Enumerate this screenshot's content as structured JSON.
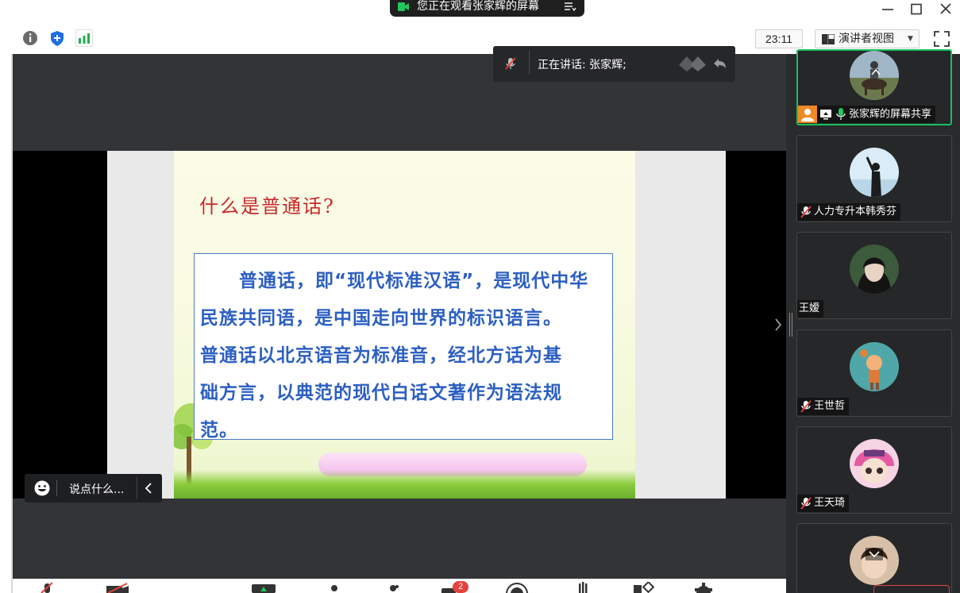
{
  "title_bar": {
    "share_notice": "您正在观看张家辉的屏幕",
    "controls": [
      "minimize",
      "maximize",
      "close"
    ]
  },
  "top_toolbar": {
    "icons": [
      "info-icon",
      "security-shield-icon",
      "network-signal-icon"
    ],
    "timer": "23:11",
    "view_label": "演讲者视图",
    "fullscreen": "fullscreen-icon"
  },
  "speaking_banner": {
    "text": "正在讲话: 张家辉;"
  },
  "slide": {
    "title": "什么是普通话?",
    "lines": [
      "普通话，即“现代标准汉语”，是现代中华",
      "民族共同语，是中国走向世界的标识语言。",
      "普通话以北京语音为标准音，经北方话为基",
      "础方言，以典范的现代白话文著作为语法规",
      "范。"
    ]
  },
  "chat": {
    "placeholder": "说点什么..."
  },
  "participants": [
    {
      "name": "张家辉的屏幕共享",
      "muted": false,
      "active": true
    },
    {
      "name": "人力专升本韩秀芬",
      "muted": true,
      "active": false
    },
    {
      "name": "王嫒",
      "muted": false,
      "active": false
    },
    {
      "name": "王世哲",
      "muted": true,
      "active": false
    },
    {
      "name": "王天琦",
      "muted": true,
      "active": false
    }
  ],
  "bottom_toolbar": {
    "chat_badge": "2"
  },
  "colors": {
    "accent_green": "#17c15d",
    "stage_bg": "#333437",
    "slide_title_red": "#c8282a",
    "slide_text_blue": "#2c5fc1",
    "badge_red": "#e5423d"
  }
}
